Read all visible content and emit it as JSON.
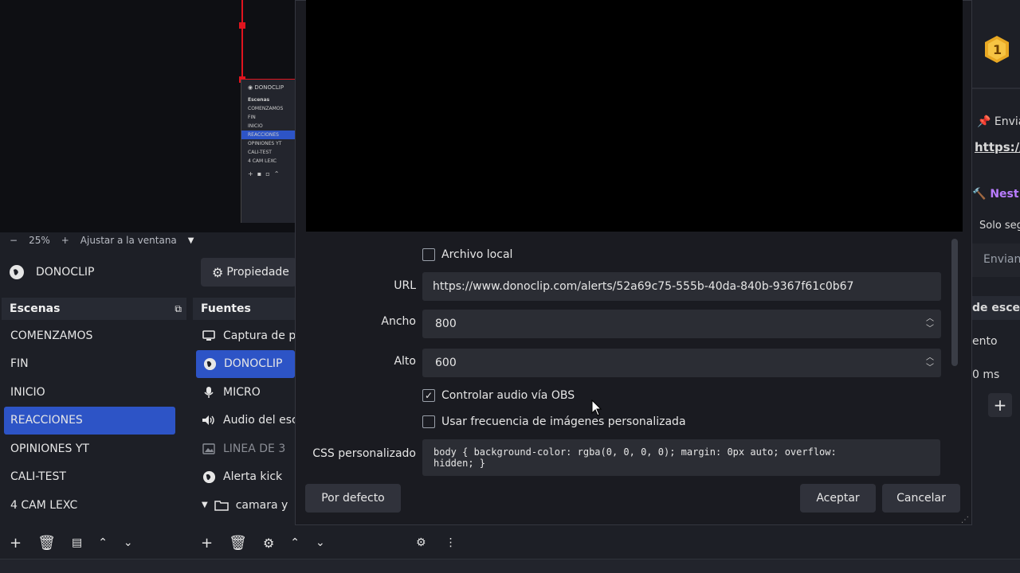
{
  "preview": {
    "mini_title": "DONOCLIP",
    "mini_section": "Escenas",
    "mini_items": [
      "COMENZAMOS",
      "FIN",
      "INICIO",
      "REACCIONES",
      "OPINIONES YT",
      "CALI-TEST",
      "4 CAM LEXC"
    ],
    "mini_selected": 3
  },
  "zoombar": {
    "minus": "−",
    "zoom": "25%",
    "plus": "+",
    "fit": "Ajustar a la ventana",
    "dropdown": "▼"
  },
  "source_bar": {
    "name": "DONOCLIP",
    "properties_label": "Propiedade"
  },
  "scenes": {
    "title": "Escenas",
    "items": [
      "COMENZAMOS",
      "FIN",
      "INICIO",
      "REACCIONES",
      "OPINIONES YT",
      "CALI-TEST",
      "4 CAM LEXC"
    ],
    "selected_index": 3
  },
  "sources": {
    "title": "Fuentes",
    "items": [
      {
        "label": "Captura de p",
        "icon": "monitor-icon"
      },
      {
        "label": "DONOCLIP",
        "icon": "globe-icon"
      },
      {
        "label": "MICRO",
        "icon": "microphone-icon"
      },
      {
        "label": "Audio del esc",
        "icon": "speaker-icon"
      },
      {
        "label": "LINEA DE 3",
        "icon": "image-icon"
      },
      {
        "label": "Alerta kick",
        "icon": "globe-icon"
      },
      {
        "label": "camara y",
        "icon": "folder-icon"
      }
    ],
    "selected_index": 1
  },
  "dialog": {
    "local_file_label": "Archivo local",
    "url_label": "URL",
    "url_value": "https://www.donoclip.com/alerts/52a69c75-555b-40da-840b-9367f61c0b67",
    "width_label": "Ancho",
    "width_value": "800",
    "height_label": "Alto",
    "height_value": "600",
    "control_audio_label": "Controlar audio vía OBS",
    "control_audio_checked": true,
    "custom_fps_label": "Usar frecuencia de imágenes personalizada",
    "custom_fps_checked": false,
    "css_label": "CSS personalizado",
    "css_value": "body { background-color: rgba(0, 0, 0, 0); margin: 0px auto; overflow:\nhidden; }",
    "defaults_button": "Por defecto",
    "accept_button": "Aceptar",
    "cancel_button": "Cancelar"
  },
  "right_dock": {
    "badge": "1",
    "send_label": "Envia",
    "link_label": "https://",
    "nest_label": "Nest",
    "only_label": "Solo seg",
    "send_btn": "Envian",
    "scenes_label": "de escen",
    "time_label": "ento",
    "ms_label": "0 ms"
  },
  "colors": {
    "accent": "#2d54c6",
    "selection_red": "#e0141e",
    "badge_gold": "#e8a823",
    "nest_purple": "#b97cff"
  }
}
